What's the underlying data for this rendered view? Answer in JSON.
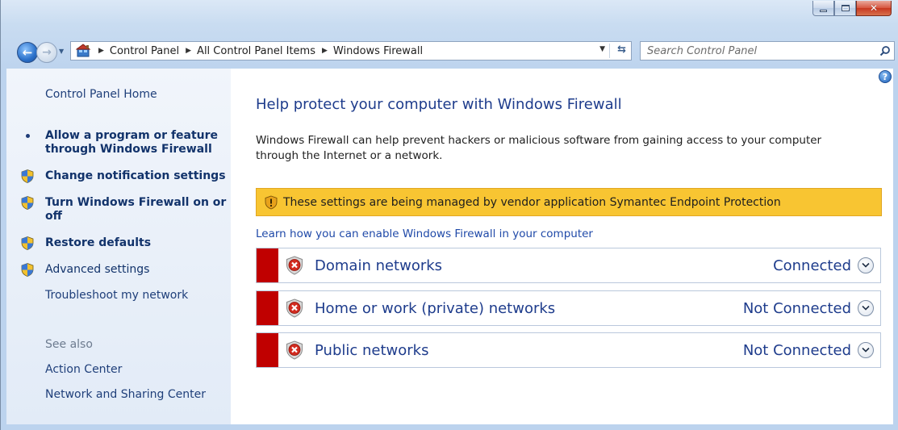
{
  "window": {
    "caption_buttons": {
      "minimize": "minimize",
      "maximize": "maximize",
      "close": "close"
    }
  },
  "navigation": {
    "breadcrumbs": [
      "Control Panel",
      "All Control Panel Items",
      "Windows Firewall"
    ],
    "search_placeholder": "Search Control Panel"
  },
  "sidebar": {
    "home_label": "Control Panel Home",
    "tasks": [
      {
        "label_line1": "Allow a program or feature",
        "label_line2": "through Windows Firewall",
        "icon": "bullet",
        "bold": true
      },
      {
        "label_line1": "Change notification settings",
        "label_line2": "",
        "icon": "uac-shield-icon",
        "bold": true
      },
      {
        "label_line1": "Turn Windows Firewall on or",
        "label_line2": "off",
        "icon": "uac-shield-icon",
        "bold": true
      },
      {
        "label_line1": "Restore defaults",
        "label_line2": "",
        "icon": "uac-shield-icon",
        "bold": true
      },
      {
        "label_line1": "Advanced settings",
        "label_line2": "",
        "icon": "uac-shield-icon",
        "bold": false
      }
    ],
    "troubleshoot_label": "Troubleshoot my network",
    "see_also_label": "See also",
    "see_also_links": [
      "Action Center",
      "Network and Sharing Center"
    ]
  },
  "main": {
    "title": "Help protect your computer with Windows Firewall",
    "intro_line1": "Windows Firewall can help prevent hackers or malicious software from gaining access to your computer",
    "intro_line2": "through the Internet or a network.",
    "managed_notice": "These settings are being managed by vendor application Symantec Endpoint Protection",
    "learn_link": "Learn how you can enable Windows Firewall in your computer",
    "networks": [
      {
        "name": "Domain networks",
        "status": "Connected"
      },
      {
        "name": "Home or work (private) networks",
        "status": "Not Connected"
      },
      {
        "name": "Public networks",
        "status": "Not Connected"
      }
    ]
  },
  "colors": {
    "link_blue": "#1e3c8c",
    "warning_yellow": "#f8c532",
    "alert_red": "#c00000"
  }
}
